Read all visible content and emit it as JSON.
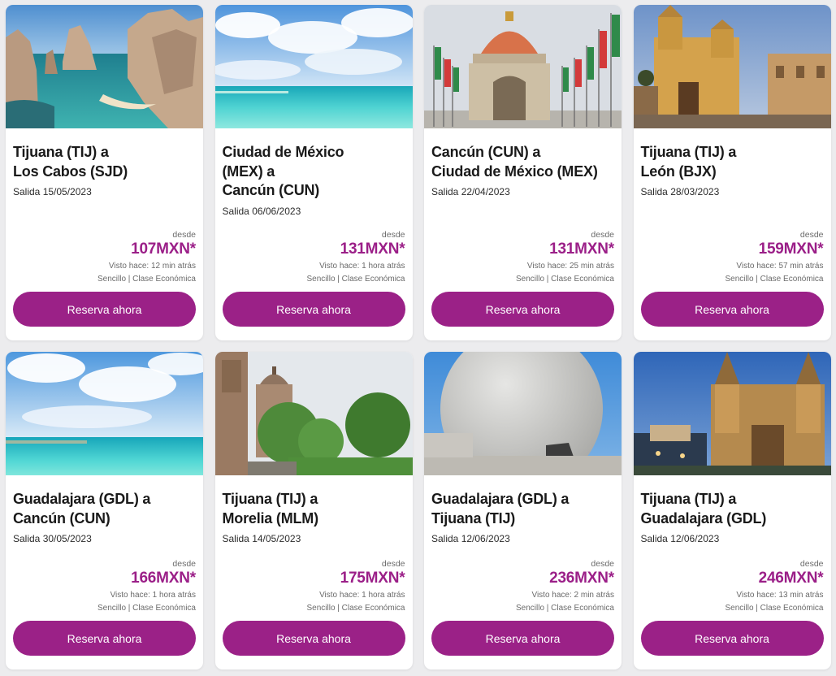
{
  "cards": [
    {
      "route": "Tijuana (TIJ) a\nLos Cabos (SJD)",
      "date": "Salida 15/05/2023",
      "desde": "desde",
      "price": "107MXN*",
      "seen": "Visto hace: 12 min atrás",
      "type": "Sencillo | Clase Económica",
      "button": "Reserva ahora",
      "image": "los-cabos-arch-photo"
    },
    {
      "route": "Ciudad de México\n(MEX) a\nCancún (CUN)",
      "date": "Salida 06/06/2023",
      "desde": "desde",
      "price": "131MXN*",
      "seen": "Visto hace: 1 hora atrás",
      "type": "Sencillo | Clase Económica",
      "button": "Reserva ahora",
      "image": "cancun-beach-photo"
    },
    {
      "route": "Cancún (CUN) a\nCiudad de México (MEX)",
      "date": "Salida 22/04/2023",
      "desde": "desde",
      "price": "131MXN*",
      "seen": "Visto hace: 25 min atrás",
      "type": "Sencillo | Clase Económica",
      "button": "Reserva ahora",
      "image": "monumento-revolucion-photo"
    },
    {
      "route": "Tijuana (TIJ) a\nLeón (BJX)",
      "date": "Salida 28/03/2023",
      "desde": "desde",
      "price": "159MXN*",
      "seen": "Visto hace: 57 min atrás",
      "type": "Sencillo | Clase Económica",
      "button": "Reserva ahora",
      "image": "guanajuato-church-photo"
    },
    {
      "route": "Guadalajara (GDL) a\nCancún (CUN)",
      "date": "Salida 30/05/2023",
      "desde": "desde",
      "price": "166MXN*",
      "seen": "Visto hace: 1 hora atrás",
      "type": "Sencillo | Clase Económica",
      "button": "Reserva ahora",
      "image": "cancun-sea-photo"
    },
    {
      "route": "Tijuana (TIJ) a\nMorelia (MLM)",
      "date": "Salida 14/05/2023",
      "desde": "desde",
      "price": "175MXN*",
      "seen": "Visto hace: 1 hora atrás",
      "type": "Sencillo | Clase Económica",
      "button": "Reserva ahora",
      "image": "morelia-cathedral-photo"
    },
    {
      "route": "Guadalajara (GDL) a\nTijuana (TIJ)",
      "date": "Salida 12/06/2023",
      "desde": "desde",
      "price": "236MXN*",
      "seen": "Visto hace: 2 min atrás",
      "type": "Sencillo | Clase Económica",
      "button": "Reserva ahora",
      "image": "tijuana-cultural-center-photo"
    },
    {
      "route": "Tijuana (TIJ) a\nGuadalajara (GDL)",
      "date": "Salida 12/06/2023",
      "desde": "desde",
      "price": "246MXN*",
      "seen": "Visto hace: 13 min atrás",
      "type": "Sencillo | Clase Económica",
      "button": "Reserva ahora",
      "image": "guadalajara-cathedral-photo"
    }
  ],
  "colors": {
    "accent": "#9b2187",
    "price": "#9b1f88",
    "background": "#ececee"
  }
}
